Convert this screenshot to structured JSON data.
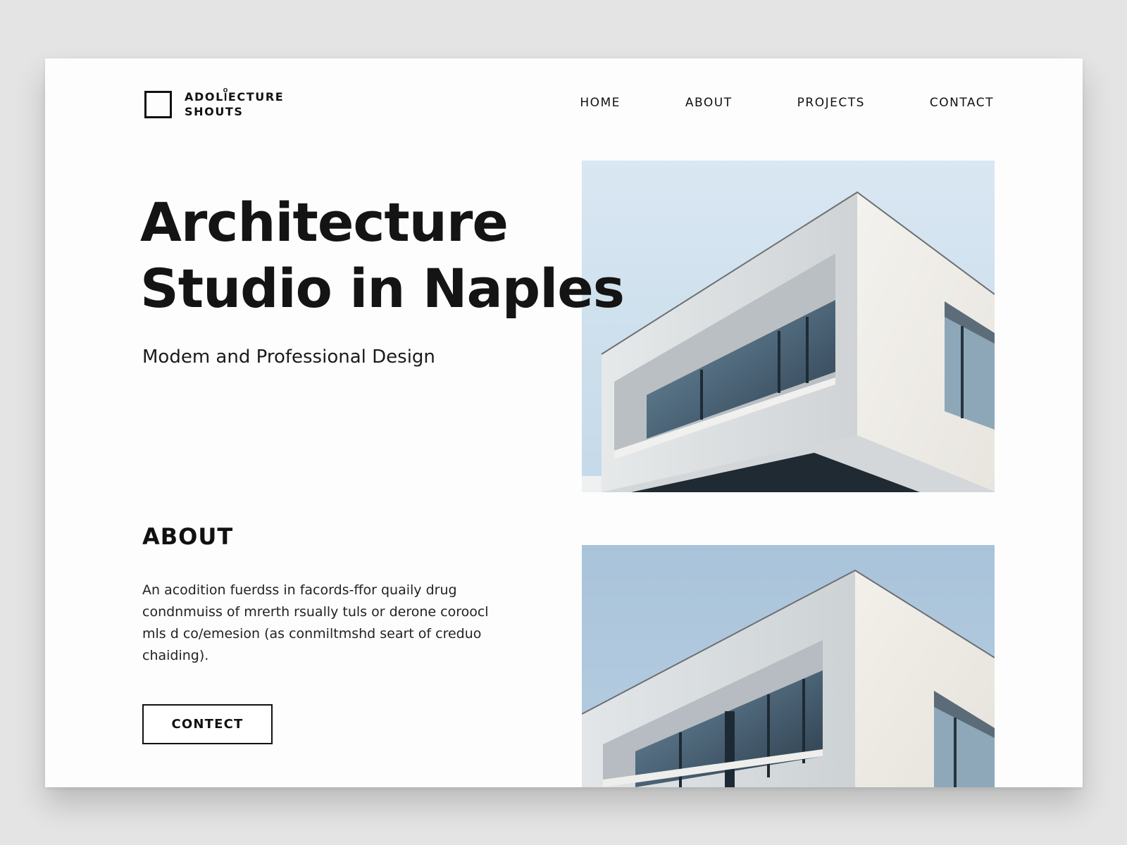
{
  "header": {
    "logo_line1": "ADOLIͦECTURE",
    "logo_line2": "SHOUTS",
    "nav": [
      {
        "label": "HOME"
      },
      {
        "label": "ABOUT"
      },
      {
        "label": "PROJECTS"
      },
      {
        "label": "CONTACT"
      }
    ]
  },
  "hero": {
    "title_line1": "Architecture",
    "title_line2": "Studio in Naples",
    "subtitle": "Modem and Professional Design"
  },
  "about": {
    "heading": "ABOUT",
    "body": "An acodition fuerdss in facords-ffor quaily drug condnmuiss of mrerth rsually tuls or derone coroocl mls d co/emesion (as conmiltmshd seart of creduo chaiding).",
    "button_label": "CONTECT"
  },
  "colors": {
    "sky_top": "#dbe8f3",
    "sky_bottom": "#a9c5dd",
    "facade": "#f1efeb",
    "accent_text": "#111111"
  }
}
